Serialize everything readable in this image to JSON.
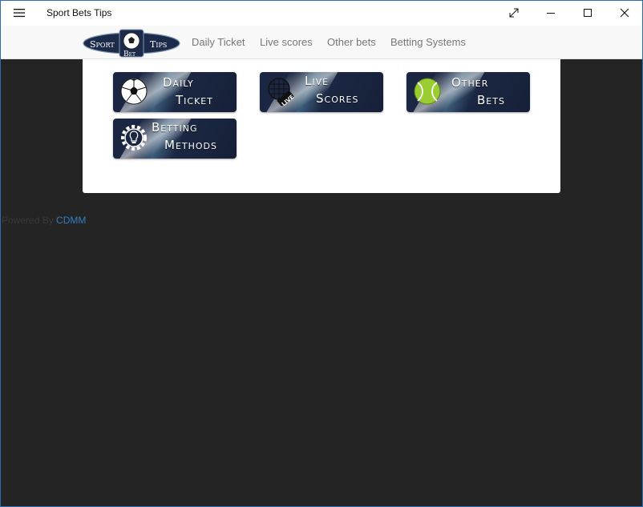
{
  "window": {
    "title": "Sport Bets Tips",
    "menu_icon": "hamburger-icon",
    "controls": [
      "fullscreen-icon",
      "minimize-icon",
      "maximize-icon",
      "close-icon"
    ]
  },
  "brand": {
    "word1": "Sport",
    "word2": "Bet",
    "word3": "Tips"
  },
  "nav": {
    "links": [
      "Daily Ticket",
      "Live scores",
      "Other bets",
      "Betting Systems"
    ]
  },
  "tiles": [
    {
      "line1": "Daily",
      "line2": "Ticket",
      "icon": "soccer-ball-icon"
    },
    {
      "line1": "Live",
      "line2": "Scores",
      "icon": "live-tennis-racket-icon"
    },
    {
      "line1": "Other",
      "line2": "Bets",
      "icon": "tennis-ball-icon"
    },
    {
      "line1": "Betting",
      "line2": "Methods",
      "icon": "gear-lightbulb-icon"
    }
  ],
  "footer": {
    "prefix": "Powered By",
    "link": "CDMM"
  },
  "colors": {
    "background": "#242424",
    "navbar": "#f8f8f8",
    "tile": "#1b2742",
    "link": "#2f7fc0"
  }
}
